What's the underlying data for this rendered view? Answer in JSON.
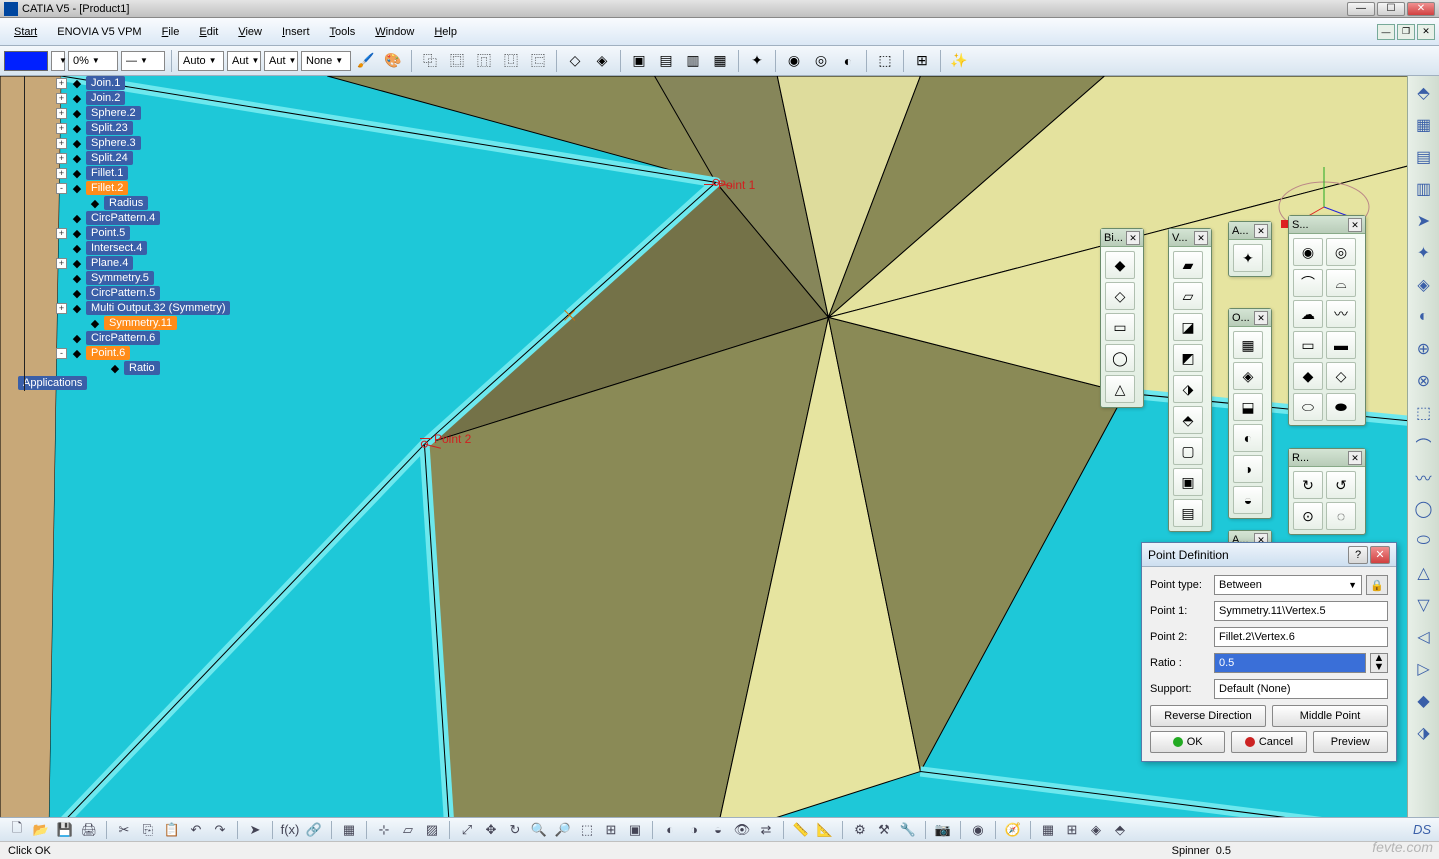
{
  "app": {
    "title": "CATIA V5 - [Product1]"
  },
  "menu": {
    "start": "Start",
    "enovia": "ENOVIA V5 VPM",
    "file": "File",
    "edit": "Edit",
    "view": "View",
    "insert": "Insert",
    "tools": "Tools",
    "window": "Window",
    "help": "Help"
  },
  "toolbar": {
    "opacity": "0%",
    "auto1": "Auto",
    "auto2": "Aut",
    "auto3": "Aut",
    "none": "None"
  },
  "tree": {
    "items": [
      {
        "label": "Join.1",
        "lvl": 1,
        "exp": "+"
      },
      {
        "label": "Join.2",
        "lvl": 1,
        "exp": "+"
      },
      {
        "label": "Sphere.2",
        "lvl": 1,
        "exp": "+"
      },
      {
        "label": "Split.23",
        "lvl": 1,
        "exp": "+"
      },
      {
        "label": "Sphere.3",
        "lvl": 1,
        "exp": "+"
      },
      {
        "label": "Split.24",
        "lvl": 1,
        "exp": "+"
      },
      {
        "label": "Fillet.1",
        "lvl": 1,
        "exp": "+"
      },
      {
        "label": "Fillet.2",
        "lvl": 1,
        "exp": "-",
        "sel": true
      },
      {
        "label": "Radius",
        "lvl": 2,
        "exp": ""
      },
      {
        "label": "CircPattern.4",
        "lvl": 1,
        "exp": ""
      },
      {
        "label": "Point.5",
        "lvl": 1,
        "exp": "+"
      },
      {
        "label": "Intersect.4",
        "lvl": 1,
        "exp": ""
      },
      {
        "label": "Plane.4",
        "lvl": 1,
        "exp": "+"
      },
      {
        "label": "Symmetry.5",
        "lvl": 1,
        "exp": ""
      },
      {
        "label": "CircPattern.5",
        "lvl": 1,
        "exp": ""
      },
      {
        "label": "Multi Output.32 (Symmetry)",
        "lvl": 1,
        "exp": "+"
      },
      {
        "label": "Symmetry.11",
        "lvl": 2,
        "exp": "",
        "sel": true
      },
      {
        "label": "CircPattern.6",
        "lvl": 1,
        "exp": ""
      },
      {
        "label": "Point.6",
        "lvl": 1,
        "exp": "-",
        "sel": true
      },
      {
        "label": "Ratio",
        "lvl": 3,
        "exp": ""
      }
    ],
    "applications": "Applications"
  },
  "viewport": {
    "point1_label": "Point 1",
    "point2_label": "Point 2"
  },
  "palettes": {
    "bi": "Bi...",
    "v": "V...",
    "a": "A...",
    "s": "S...",
    "o": "O...",
    "r": "R...",
    "a2": "A..."
  },
  "dialog": {
    "title": "Point Definition",
    "type_label": "Point type:",
    "type_value": "Between",
    "p1_label": "Point 1:",
    "p1_value": "Symmetry.11\\Vertex.5",
    "p2_label": "Point 2:",
    "p2_value": "Fillet.2\\Vertex.6",
    "ratio_label": "Ratio :",
    "ratio_value": "0.5",
    "support_label": "Support:",
    "support_value": "Default (None)",
    "reverse": "Reverse Direction",
    "middle": "Middle Point",
    "ok": "OK",
    "cancel": "Cancel",
    "preview": "Preview"
  },
  "status": {
    "left": "Click OK",
    "spinner_label": "Spinner",
    "spinner_value": "0.5"
  },
  "watermark": "fevte.com"
}
